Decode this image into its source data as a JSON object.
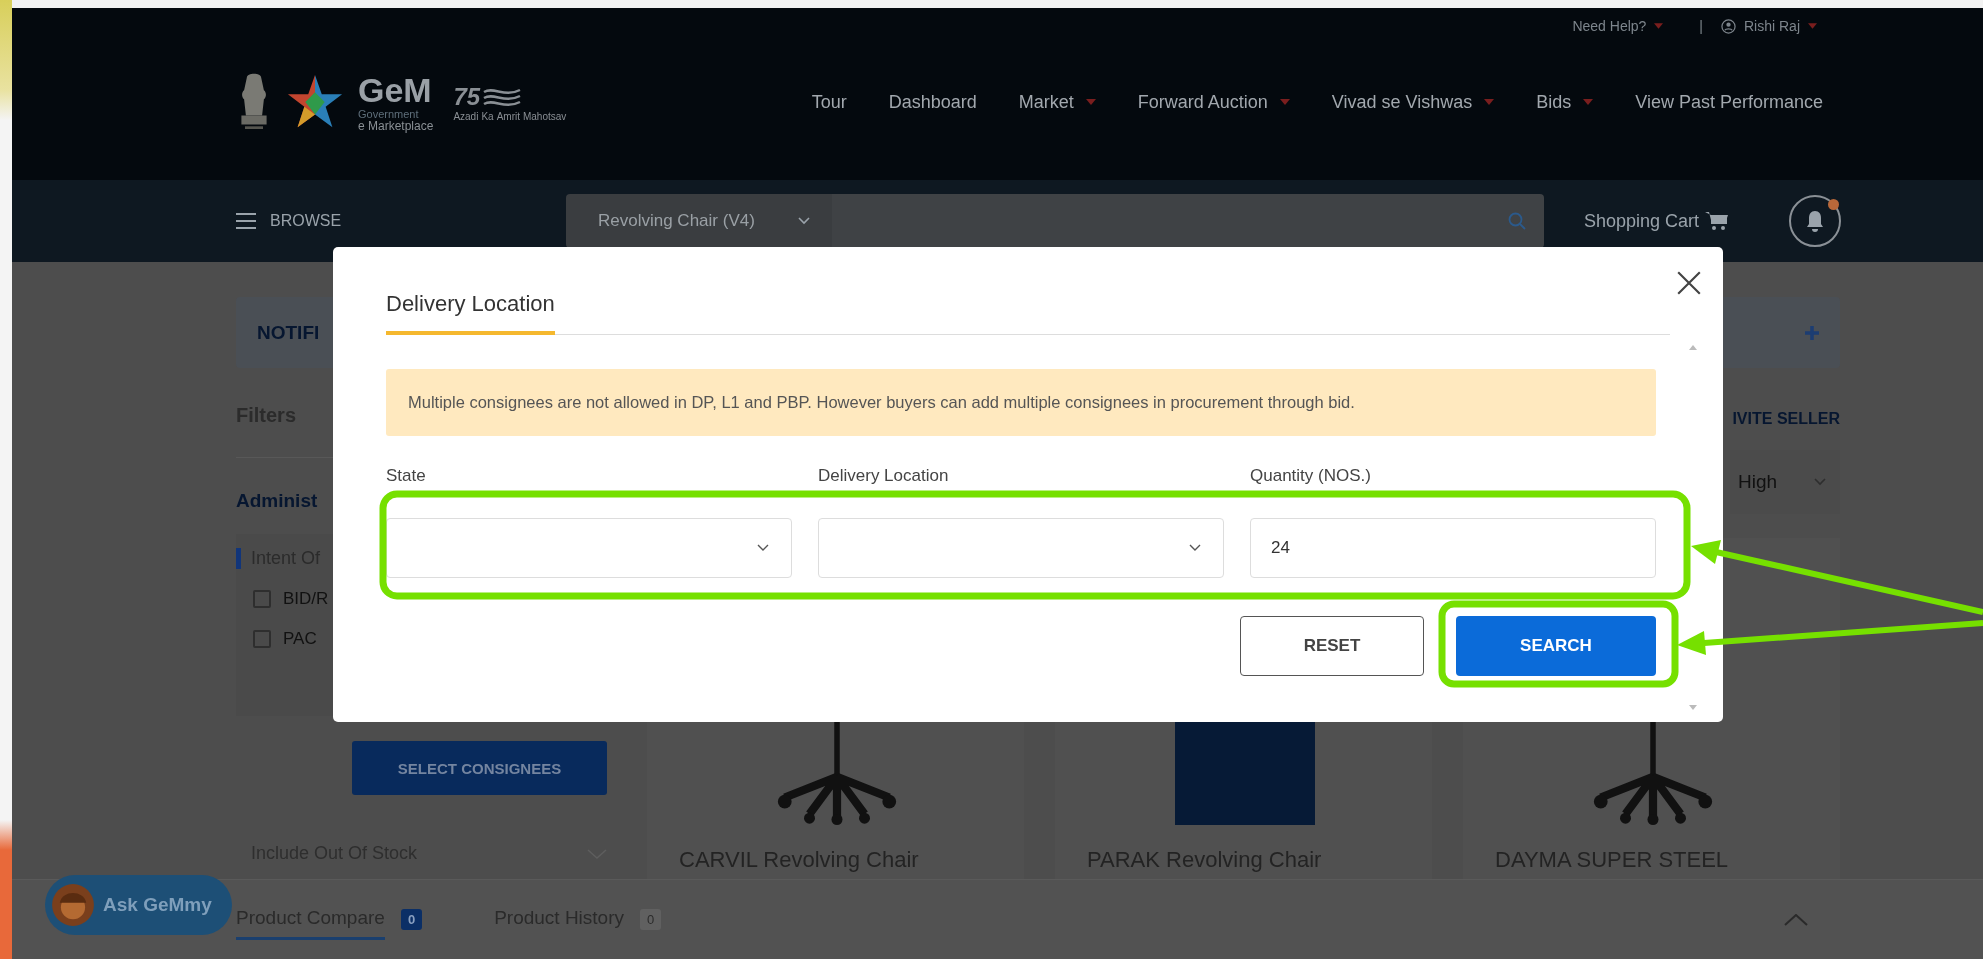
{
  "top_bar": {
    "help": "Need Help?",
    "separator": "|",
    "user": "Rishi Raj"
  },
  "logo": {
    "name": "GeM",
    "tagline_1": "Government",
    "tagline_2": "e Marketplace",
    "badge_number": "75",
    "badge_words": [
      "Azadi",
      "Ka",
      "Amrit",
      "Mahotsav"
    ]
  },
  "nav": [
    {
      "label": "Tour",
      "dropdown": false
    },
    {
      "label": "Dashboard",
      "dropdown": false
    },
    {
      "label": "Market",
      "dropdown": true
    },
    {
      "label": "Forward Auction",
      "dropdown": true
    },
    {
      "label": "Vivad se Vishwas",
      "dropdown": true
    },
    {
      "label": "Bids",
      "dropdown": true
    },
    {
      "label": "View Past Performance",
      "dropdown": false
    }
  ],
  "browse": "BROWSE",
  "search": {
    "category": "Revolving Chair (V4)"
  },
  "cart": "Shopping Cart",
  "notifications": {
    "unread": true
  },
  "notice_bar": {
    "title": "NOTIFI"
  },
  "sidebar": {
    "filters_title": "Filters",
    "section": "Administ",
    "group": "Intent Of",
    "options": [
      {
        "label": "BID/R",
        "checked": false
      },
      {
        "label": "PAC",
        "checked": false
      }
    ],
    "select_button": "SELECT CONSIGNEES",
    "stock_filter": "Include Out Of Stock"
  },
  "results": {
    "invite": "IVITE SELLER",
    "sort": "High"
  },
  "products": [
    {
      "name": "CARVIL Revolving Chair",
      "kind": "chair"
    },
    {
      "name": "PARAK Revolving Chair",
      "kind": "photo"
    },
    {
      "name": "DAYMA SUPER STEEL",
      "kind": "chair"
    }
  ],
  "assistant": "Ask GeMmy",
  "bottom_bar": {
    "tabs": [
      {
        "label": "Product Compare",
        "count": "0",
        "selected": true
      },
      {
        "label": "Product History",
        "count": "0",
        "selected": false
      }
    ]
  },
  "modal": {
    "tabs": [
      {
        "label": "Delivery Location",
        "selected": true
      }
    ],
    "notice": "Multiple consignees are not allowed in DP, L1 and PBP. However buyers can add multiple consignees in procurement through bid.",
    "fields": [
      {
        "label": "State",
        "kind": "select"
      },
      {
        "label": "Delivery Location",
        "kind": "select"
      },
      {
        "label": "Quantity (NOS.)",
        "kind": "input",
        "value": "24"
      }
    ],
    "buttons": [
      {
        "label": "RESET",
        "kind": "secondary"
      },
      {
        "label": "SEARCH",
        "kind": "primary"
      }
    ]
  }
}
